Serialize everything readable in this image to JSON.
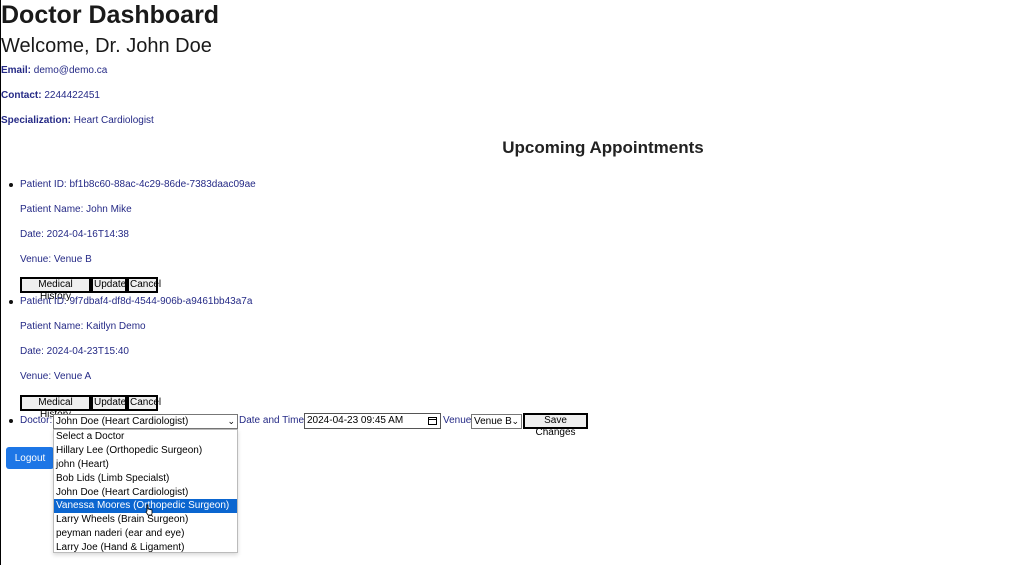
{
  "header": {
    "title": "Doctor Dashboard",
    "welcome": "Welcome, Dr. John Doe"
  },
  "profile": {
    "email_label": "Email:",
    "email": "demo@demo.ca",
    "contact_label": "Contact:",
    "contact": "2244422451",
    "specialization_label": "Specialization:",
    "specialization": "Heart Cardiologist"
  },
  "appointments_heading": "Upcoming Appointments",
  "appointments": [
    {
      "patient_id": "Patient ID: bf1b8c60-88ac-4c29-86de-7383daac09ae",
      "patient_name": "Patient Name: John Mike",
      "date": "Date: 2024-04-16T14:38",
      "venue": "Venue: Venue B"
    },
    {
      "patient_id": "Patient ID: 9f7dbaf4-df8d-4544-906b-a9461bb43a7a",
      "patient_name": "Patient Name: Kaitlyn Demo",
      "date": "Date: 2024-04-23T15:40",
      "venue": "Venue: Venue A"
    }
  ],
  "buttons": {
    "medical_history": "Medical History",
    "update": "Update",
    "cancel": "Cancel",
    "save_changes": "Save Changes",
    "logout": "Logout"
  },
  "edit_form": {
    "doctor_label": "Doctor:",
    "doctor_selected": "John Doe (Heart Cardiologist)",
    "datetime_label": "Date and Time:",
    "datetime_value": "2024-04-23 09:45 AM",
    "venue_label": "Venue:",
    "venue_selected": "Venue B"
  },
  "doctor_options": [
    "Select a Doctor",
    "Hillary Lee (Orthopedic Surgeon)",
    "john (Heart)",
    "Bob Lids (Limb Specialst)",
    "John Doe (Heart Cardiologist)",
    "Vanessa Moores (Orthopedic Surgeon)",
    "Larry Wheels (Brain Surgeon)",
    "peyman naderi (ear and eye)",
    "Larry Joe (Hand & Ligament)"
  ],
  "highlighted_option": "Vanessa Moores (Orthopedic Surgeon)",
  "colors": {
    "accent": "#1d76e6",
    "highlight": "#0b66d0",
    "text_navy": "#252a86"
  }
}
